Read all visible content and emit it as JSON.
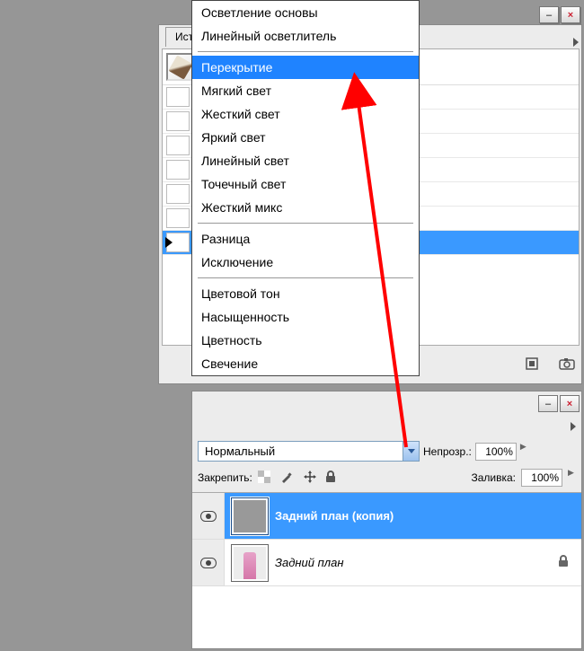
{
  "history_panel": {
    "tab": "Исто",
    "window_controls": {
      "minimize": "–",
      "close": "×"
    },
    "rows_count": 7,
    "selected_row_index": 6,
    "bottom_icons": [
      "document-icon",
      "camera-icon",
      "trash-icon"
    ]
  },
  "layers_panel": {
    "window_controls": {
      "minimize": "–",
      "close": "×"
    },
    "blend_mode_label": "Нормальный",
    "opacity_label": "Непрозр.:",
    "opacity_value": "100%",
    "lock_label": "Закрепить:",
    "lock_icons": [
      "checker-icon",
      "brush-icon",
      "move-icon",
      "lock-icon"
    ],
    "fill_label": "Заливка:",
    "fill_value": "100%",
    "layers": [
      {
        "name": "Задний план (копия)",
        "active": true,
        "locked": false
      },
      {
        "name": "Задний план",
        "active": false,
        "locked": true
      }
    ]
  },
  "blend_dropdown": {
    "groups": [
      [
        "Осветление основы",
        "Линейный осветлитель"
      ],
      [
        "Перекрытие",
        "Мягкий свет",
        "Жесткий свет",
        "Яркий свет",
        "Линейный свет",
        "Точечный свет",
        "Жесткий микс"
      ],
      [
        "Разница",
        "Исключение"
      ],
      [
        "Цветовой тон",
        "Насыщенность",
        "Цветность",
        "Свечение"
      ]
    ],
    "selected": "Перекрытие"
  }
}
